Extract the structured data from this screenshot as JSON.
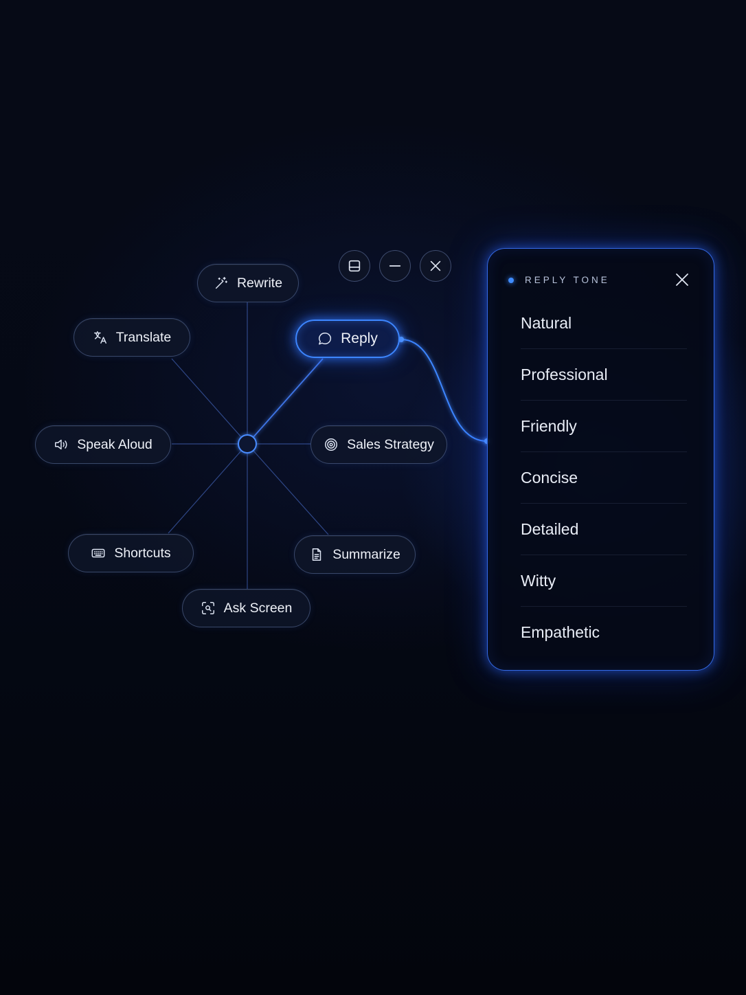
{
  "menu": {
    "rewrite": "Rewrite",
    "translate": "Translate",
    "reply": "Reply",
    "speak_aloud": "Speak Aloud",
    "sales_strategy": "Sales Strategy",
    "shortcuts": "Shortcuts",
    "summarize": "Summarize",
    "ask_screen": "Ask Screen"
  },
  "active_item": "Reply",
  "window_controls": [
    "panel-icon",
    "minimize-icon",
    "close-icon"
  ],
  "panel": {
    "title": "REPLY TONE",
    "tones": [
      "Natural",
      "Professional",
      "Friendly",
      "Concise",
      "Detailed",
      "Witty",
      "Empathetic"
    ]
  },
  "colors": {
    "accent": "#3d86ff",
    "background": "#050915",
    "pill": "#0f162a"
  }
}
